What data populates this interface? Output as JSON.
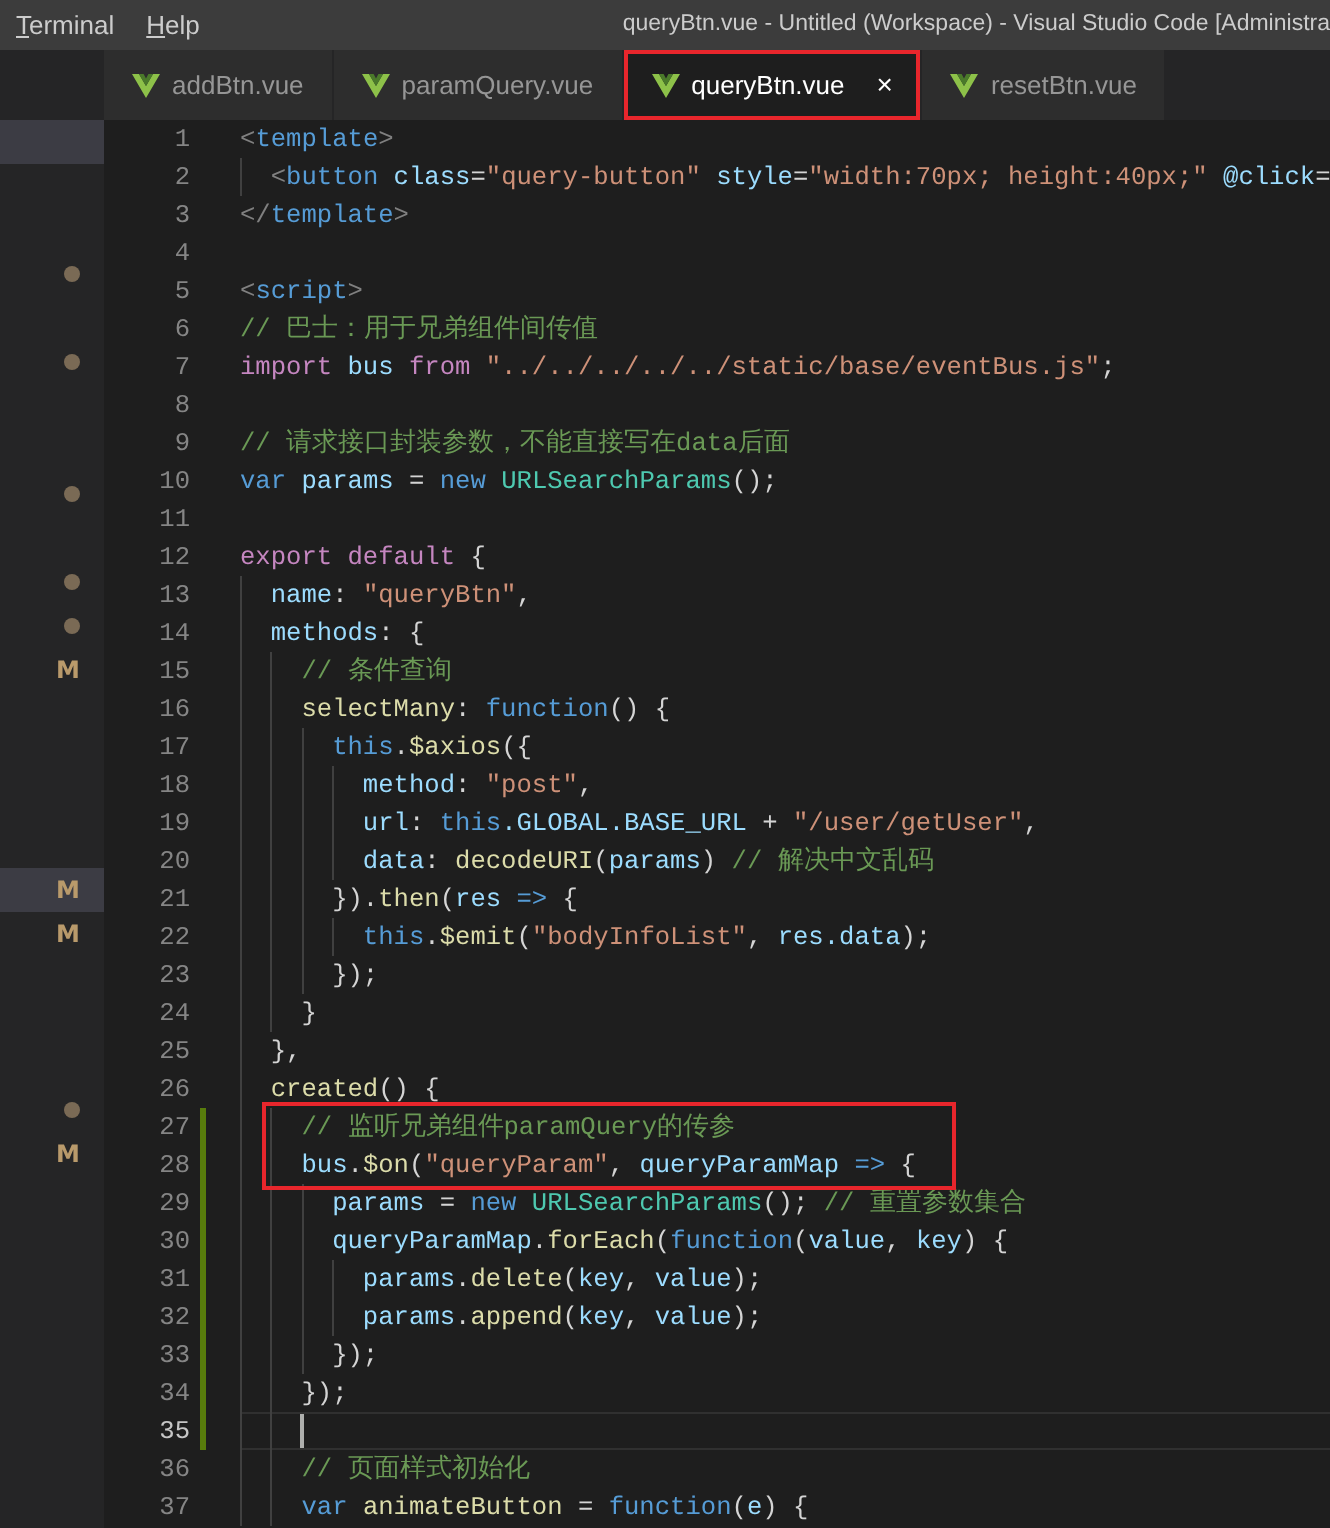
{
  "menu": [
    {
      "label": "Terminal",
      "mnemonic_underlined": true
    },
    {
      "label": "Help",
      "mnemonic_underlined": true
    }
  ],
  "window": {
    "title": "queryBtn.vue - Untitled (Workspace) - Visual Studio Code [Administra"
  },
  "tabs": [
    {
      "label": "addBtn.vue",
      "selected": false,
      "annotated": false
    },
    {
      "label": "paramQuery.vue",
      "selected": false,
      "annotated": false
    },
    {
      "label": "queryBtn.vue",
      "selected": true,
      "annotated": true,
      "close": "×"
    },
    {
      "label": "resetBtn.vue",
      "selected": false,
      "annotated": false
    }
  ],
  "sidebar": {
    "rows": [
      {
        "kind": "plain",
        "selected": true
      },
      {
        "kind": "plain",
        "selected": false
      },
      {
        "kind": "plain",
        "selected": false
      },
      {
        "kind": "dot",
        "selected": false
      },
      {
        "kind": "plain",
        "selected": false
      },
      {
        "kind": "dot",
        "selected": false
      },
      {
        "kind": "plain",
        "selected": false
      },
      {
        "kind": "plain",
        "selected": false
      },
      {
        "kind": "dot",
        "selected": false
      },
      {
        "kind": "plain",
        "selected": false
      },
      {
        "kind": "dot",
        "selected": false
      },
      {
        "kind": "dot",
        "selected": false
      },
      {
        "kind": "letter",
        "text": "M",
        "selected": false
      },
      {
        "kind": "plain",
        "selected": false
      },
      {
        "kind": "plain",
        "selected": false
      },
      {
        "kind": "plain",
        "selected": false
      },
      {
        "kind": "plain",
        "selected": false
      },
      {
        "kind": "letter",
        "text": "M",
        "selected": true
      },
      {
        "kind": "letter",
        "text": "M",
        "selected": false
      },
      {
        "kind": "plain",
        "selected": false
      },
      {
        "kind": "plain",
        "selected": false
      },
      {
        "kind": "plain",
        "selected": false
      },
      {
        "kind": "dot",
        "selected": false
      },
      {
        "kind": "letter",
        "text": "M",
        "selected": false
      }
    ]
  },
  "editor": {
    "lines": [
      {
        "number": "1",
        "tokens": [
          {
            "text": "<",
            "kind": "bracket"
          },
          {
            "text": "template",
            "kind": "tag"
          },
          {
            "text": ">",
            "kind": "bracket"
          }
        ]
      },
      {
        "number": "2",
        "tokens": [
          {
            "text": "  <",
            "kind": "bracket"
          },
          {
            "text": "button",
            "kind": "tag"
          },
          {
            "text": " class",
            "kind": "attribute"
          },
          {
            "text": "=",
            "kind": "punct"
          },
          {
            "text": "\"query-button\"",
            "kind": "string"
          },
          {
            "text": " style",
            "kind": "attribute"
          },
          {
            "text": "=",
            "kind": "punct"
          },
          {
            "text": "\"width:70px; height:40px;\"",
            "kind": "string"
          },
          {
            "text": " @click",
            "kind": "attribute"
          },
          {
            "text": "=",
            "kind": "punct"
          }
        ]
      },
      {
        "number": "3",
        "tokens": [
          {
            "text": "</",
            "kind": "bracket"
          },
          {
            "text": "template",
            "kind": "tag"
          },
          {
            "text": ">",
            "kind": "bracket"
          }
        ]
      },
      {
        "number": "4"
      },
      {
        "number": "5",
        "tokens": [
          {
            "text": "<",
            "kind": "bracket"
          },
          {
            "text": "script",
            "kind": "tag"
          },
          {
            "text": ">",
            "kind": "bracket"
          }
        ]
      },
      {
        "number": "6",
        "tokens": [
          {
            "text": "// 巴士：用于兄弟组件间传值",
            "kind": "comment"
          }
        ]
      },
      {
        "number": "7",
        "tokens": [
          {
            "text": "import",
            "kind": "keyword"
          },
          {
            "text": " bus",
            "kind": "variable"
          },
          {
            "text": " from",
            "kind": "keyword"
          },
          {
            "text": " \"../../../../../static/base/eventBus.js\"",
            "kind": "string"
          },
          {
            "text": ";",
            "kind": "punct"
          }
        ]
      },
      {
        "number": "8"
      },
      {
        "number": "9",
        "tokens": [
          {
            "text": "// 请求接口封装参数，不能直接写在data后面",
            "kind": "comment"
          }
        ]
      },
      {
        "number": "10",
        "tokens": [
          {
            "text": "var",
            "kind": "storage"
          },
          {
            "text": " params",
            "kind": "variable"
          },
          {
            "text": " = ",
            "kind": "punct"
          },
          {
            "text": "new",
            "kind": "storage"
          },
          {
            "text": " URLSearchParams",
            "kind": "class"
          },
          {
            "text": "();",
            "kind": "punct"
          }
        ]
      },
      {
        "number": "11"
      },
      {
        "number": "12",
        "tokens": [
          {
            "text": "export",
            "kind": "keyword"
          },
          {
            "text": " default",
            "kind": "keyword"
          },
          {
            "text": " {",
            "kind": "punct"
          }
        ]
      },
      {
        "number": "13",
        "tokens": [
          {
            "text": "  name",
            "kind": "variable"
          },
          {
            "text": ": ",
            "kind": "punct"
          },
          {
            "text": "\"queryBtn\"",
            "kind": "string"
          },
          {
            "text": ",",
            "kind": "punct"
          }
        ]
      },
      {
        "number": "14",
        "tokens": [
          {
            "text": "  methods",
            "kind": "variable"
          },
          {
            "text": ": {",
            "kind": "punct"
          }
        ]
      },
      {
        "number": "15",
        "tokens": [
          {
            "text": "    // 条件查询",
            "kind": "comment"
          }
        ]
      },
      {
        "number": "16",
        "tokens": [
          {
            "text": "    selectMany",
            "kind": "function"
          },
          {
            "text": ": ",
            "kind": "punct"
          },
          {
            "text": "function",
            "kind": "storage"
          },
          {
            "text": "() {",
            "kind": "punct"
          }
        ]
      },
      {
        "number": "17",
        "tokens": [
          {
            "text": "      this",
            "kind": "storage"
          },
          {
            "text": ".",
            "kind": "punct"
          },
          {
            "text": "$axios",
            "kind": "function"
          },
          {
            "text": "({",
            "kind": "punct"
          }
        ]
      },
      {
        "number": "18",
        "tokens": [
          {
            "text": "        method",
            "kind": "variable"
          },
          {
            "text": ": ",
            "kind": "punct"
          },
          {
            "text": "\"post\"",
            "kind": "string"
          },
          {
            "text": ",",
            "kind": "punct"
          }
        ]
      },
      {
        "number": "19",
        "tokens": [
          {
            "text": "        url",
            "kind": "variable"
          },
          {
            "text": ": ",
            "kind": "punct"
          },
          {
            "text": "this",
            "kind": "storage"
          },
          {
            "text": ".GLOBAL.BASE_URL",
            "kind": "variable"
          },
          {
            "text": " + ",
            "kind": "punct"
          },
          {
            "text": "\"/user/getUser\"",
            "kind": "string"
          },
          {
            "text": ",",
            "kind": "punct"
          }
        ]
      },
      {
        "number": "20",
        "tokens": [
          {
            "text": "        data",
            "kind": "variable"
          },
          {
            "text": ": ",
            "kind": "punct"
          },
          {
            "text": "decodeURI",
            "kind": "function"
          },
          {
            "text": "(",
            "kind": "punct"
          },
          {
            "text": "params",
            "kind": "variable"
          },
          {
            "text": ") ",
            "kind": "punct"
          },
          {
            "text": "// 解决中文乱码",
            "kind": "comment"
          }
        ]
      },
      {
        "number": "21",
        "tokens": [
          {
            "text": "      }).",
            "kind": "punct"
          },
          {
            "text": "then",
            "kind": "function"
          },
          {
            "text": "(",
            "kind": "punct"
          },
          {
            "text": "res",
            "kind": "variable"
          },
          {
            "text": " =>",
            "kind": "storage"
          },
          {
            "text": " {",
            "kind": "punct"
          }
        ]
      },
      {
        "number": "22",
        "tokens": [
          {
            "text": "        this",
            "kind": "storage"
          },
          {
            "text": ".",
            "kind": "punct"
          },
          {
            "text": "$emit",
            "kind": "function"
          },
          {
            "text": "(",
            "kind": "punct"
          },
          {
            "text": "\"bodyInfoList\"",
            "kind": "string"
          },
          {
            "text": ", ",
            "kind": "punct"
          },
          {
            "text": "res.data",
            "kind": "variable"
          },
          {
            "text": ");",
            "kind": "punct"
          }
        ]
      },
      {
        "number": "23",
        "tokens": [
          {
            "text": "      });",
            "kind": "punct"
          }
        ]
      },
      {
        "number": "24",
        "tokens": [
          {
            "text": "    }",
            "kind": "punct"
          }
        ]
      },
      {
        "number": "25",
        "tokens": [
          {
            "text": "  },",
            "kind": "punct"
          }
        ]
      },
      {
        "number": "26",
        "tokens": [
          {
            "text": "  created",
            "kind": "function"
          },
          {
            "text": "() {",
            "kind": "punct"
          }
        ]
      },
      {
        "number": "27",
        "modified": true,
        "boxed": true,
        "tokens": [
          {
            "text": "    // 监听兄弟组件paramQuery的传参",
            "kind": "comment"
          }
        ]
      },
      {
        "number": "28",
        "modified": true,
        "boxed": true,
        "tokens": [
          {
            "text": "    bus",
            "kind": "variable"
          },
          {
            "text": ".",
            "kind": "punct"
          },
          {
            "text": "$on",
            "kind": "function"
          },
          {
            "text": "(",
            "kind": "punct"
          },
          {
            "text": "\"queryParam\"",
            "kind": "string"
          },
          {
            "text": ", ",
            "kind": "punct"
          },
          {
            "text": "queryParamMap",
            "kind": "variable"
          },
          {
            "text": " =>",
            "kind": "storage"
          },
          {
            "text": " {",
            "kind": "punct"
          }
        ]
      },
      {
        "number": "29",
        "modified": true,
        "tokens": [
          {
            "text": "      params",
            "kind": "variable"
          },
          {
            "text": " = ",
            "kind": "punct"
          },
          {
            "text": "new",
            "kind": "storage"
          },
          {
            "text": " URLSearchParams",
            "kind": "class"
          },
          {
            "text": "(); ",
            "kind": "punct"
          },
          {
            "text": "// 重置参数集合",
            "kind": "comment"
          }
        ]
      },
      {
        "number": "30",
        "modified": true,
        "tokens": [
          {
            "text": "      queryParamMap",
            "kind": "variable"
          },
          {
            "text": ".",
            "kind": "punct"
          },
          {
            "text": "forEach",
            "kind": "function"
          },
          {
            "text": "(",
            "kind": "punct"
          },
          {
            "text": "function",
            "kind": "storage"
          },
          {
            "text": "(",
            "kind": "punct"
          },
          {
            "text": "value",
            "kind": "variable"
          },
          {
            "text": ", ",
            "kind": "punct"
          },
          {
            "text": "key",
            "kind": "variable"
          },
          {
            "text": ") {",
            "kind": "punct"
          }
        ]
      },
      {
        "number": "31",
        "modified": true,
        "tokens": [
          {
            "text": "        params",
            "kind": "variable"
          },
          {
            "text": ".",
            "kind": "punct"
          },
          {
            "text": "delete",
            "kind": "function"
          },
          {
            "text": "(",
            "kind": "punct"
          },
          {
            "text": "key",
            "kind": "variable"
          },
          {
            "text": ", ",
            "kind": "punct"
          },
          {
            "text": "value",
            "kind": "variable"
          },
          {
            "text": ");",
            "kind": "punct"
          }
        ]
      },
      {
        "number": "32",
        "modified": true,
        "tokens": [
          {
            "text": "        params",
            "kind": "variable"
          },
          {
            "text": ".",
            "kind": "punct"
          },
          {
            "text": "append",
            "kind": "function"
          },
          {
            "text": "(",
            "kind": "punct"
          },
          {
            "text": "key",
            "kind": "variable"
          },
          {
            "text": ", ",
            "kind": "punct"
          },
          {
            "text": "value",
            "kind": "variable"
          },
          {
            "text": ");",
            "kind": "punct"
          }
        ]
      },
      {
        "number": "33",
        "modified": true,
        "tokens": [
          {
            "text": "      });",
            "kind": "punct"
          }
        ]
      },
      {
        "number": "34",
        "modified": true,
        "tokens": [
          {
            "text": "    });",
            "kind": "punct"
          }
        ]
      },
      {
        "number": "35",
        "modified": true,
        "current": true,
        "cursor": true
      },
      {
        "number": "36",
        "tokens": [
          {
            "text": "    // 页面样式初始化",
            "kind": "comment"
          }
        ]
      },
      {
        "number": "37",
        "tokens": [
          {
            "text": "    var",
            "kind": "storage"
          },
          {
            "text": " animateButton",
            "kind": "function"
          },
          {
            "text": " = ",
            "kind": "punct"
          },
          {
            "text": "function",
            "kind": "storage"
          },
          {
            "text": "(",
            "kind": "punct"
          },
          {
            "text": "e",
            "kind": "variable"
          },
          {
            "text": ") {",
            "kind": "punct"
          }
        ]
      }
    ]
  }
}
